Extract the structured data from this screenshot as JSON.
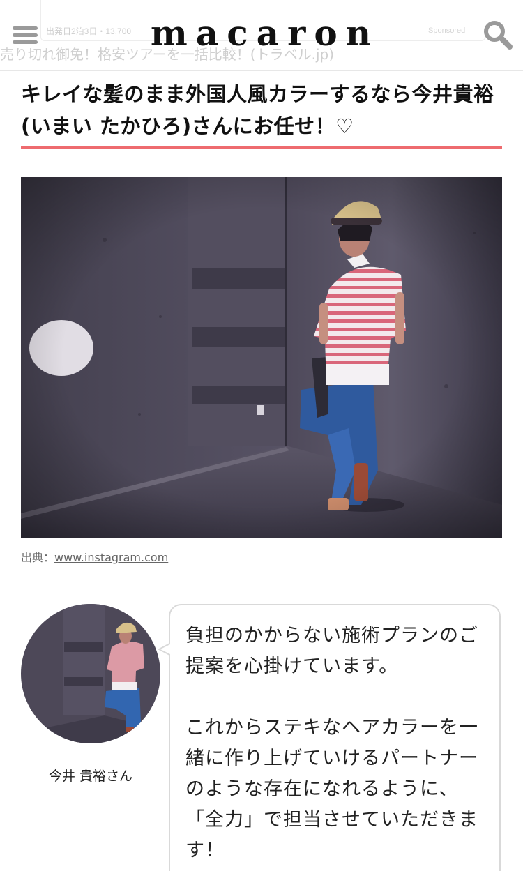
{
  "header": {
    "logo": "macaron",
    "behind_ad": {
      "meta": "出発日2泊3日・13,700",
      "label": "Sponsored",
      "headline": "売り切れ御免！格安ツアーを一括比較！(トラベル.jp)"
    }
  },
  "article": {
    "title": "キレイな髪のまま外国人風カラーするなら今井貴裕(いまい たかひろ)さんにお任せ！♡",
    "accent_color": "#ee6b6f",
    "photo_caption": {
      "prefix": "出典：",
      "link_text": "www.instagram.com"
    },
    "speaker": {
      "name": "今井 貴裕さん",
      "quote_paragraphs": [
        "負担のかからない施術プランのご提案を心掛けています。",
        "これからステキなヘアカラーを一緒に作り上げていけるパートナーのような存在になれるように、「全力」で担当させていただきます！"
      ]
    }
  }
}
